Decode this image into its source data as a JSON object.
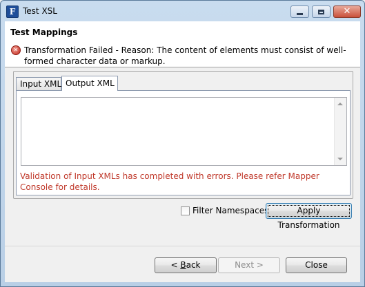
{
  "window": {
    "title": "Test XSL",
    "app_icon_letter": "F",
    "minimize_icon": "minimize-icon",
    "maximize_icon": "maximize-icon",
    "close_icon": "close-icon"
  },
  "header": {
    "title": "Test Mappings",
    "error_icon": "error-icon",
    "error_message": "Transformation Failed - Reason: The content of elements must consist of well-formed character data or markup."
  },
  "tabs": [
    {
      "label": "Input XML",
      "selected": false
    },
    {
      "label": "Output XML",
      "selected": true
    }
  ],
  "output_text": "",
  "validation_message": "Validation of Input XMLs has completed with errors. Please refer Mapper Console for details.",
  "options": {
    "filter_namespaces_label": "Filter Namespaces",
    "filter_namespaces_checked": false
  },
  "buttons": {
    "apply": "Apply Transformation",
    "back_prefix": "< ",
    "back_mnemonic": "B",
    "back_rest": "ack",
    "next": "Next >",
    "close": "Close"
  },
  "colors": {
    "error_text": "#c0392b",
    "title_bar": "#c9dcef"
  }
}
